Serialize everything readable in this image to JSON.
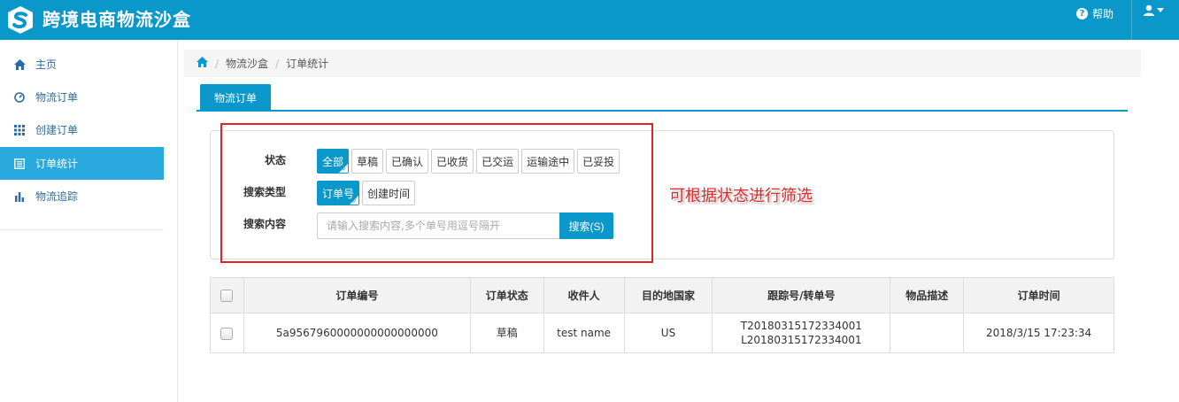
{
  "header": {
    "app_title": "跨境电商物流沙盒",
    "help_label": "帮助",
    "icons": {
      "logo": "s-logo-icon",
      "help": "question-circle-icon",
      "user": "user-icon",
      "caret": "caret-down-icon"
    },
    "accent_color": "#0a97c9"
  },
  "sidebar": {
    "items": [
      {
        "label": "主页",
        "icon": "home-icon",
        "active": false
      },
      {
        "label": "物流订单",
        "icon": "dashboard-icon",
        "active": false
      },
      {
        "label": "创建订单",
        "icon": "grid-icon",
        "active": false
      },
      {
        "label": "订单统计",
        "icon": "list-icon",
        "active": true
      },
      {
        "label": "物流追踪",
        "icon": "bar-chart-icon",
        "active": false
      }
    ]
  },
  "breadcrumb": {
    "items": [
      "物流沙盒",
      "订单统计"
    ]
  },
  "tab": {
    "label": "物流订单"
  },
  "filters": {
    "status_label": "状态",
    "status_options": [
      "全部",
      "草稿",
      "已确认",
      "已收货",
      "已交运",
      "运输途中",
      "已妥投"
    ],
    "status_selected": "全部",
    "search_type_label": "搜索类型",
    "search_type_options": [
      "订单号",
      "创建时间"
    ],
    "search_type_selected": "订单号",
    "search_content_label": "搜索内容",
    "search_placeholder": "请输入搜索内容,多个单号用逗号隔开",
    "search_button": "搜索(S)"
  },
  "annotation": {
    "text": "可根据状态进行筛选",
    "color": "#e02a2a"
  },
  "table": {
    "headers": [
      "订单编号",
      "订单状态",
      "收件人",
      "目的地国家",
      "跟踪号/转单号",
      "物品描述",
      "订单时间"
    ],
    "rows": [
      {
        "order_no": "5a9567960000000000000000",
        "status": "草稿",
        "recipient": "test name",
        "country": "US",
        "tracking_no": "T20180315172334001",
        "transfer_no": "L20180315172334001",
        "description": "",
        "order_time": "2018/3/15 17:23:34"
      }
    ]
  }
}
